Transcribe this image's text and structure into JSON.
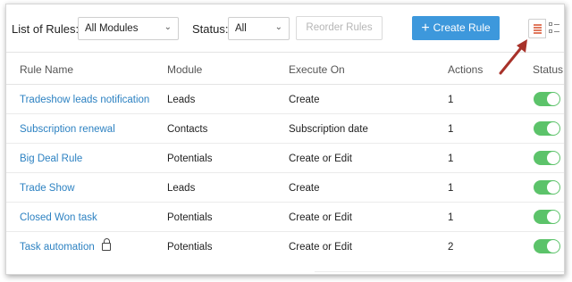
{
  "toolbar": {
    "list_label": "List of Rules:",
    "module_select": "All Modules",
    "status_label": "Status:",
    "status_select": "All",
    "reorder_label": "Reorder Rules",
    "create_plus": "+",
    "create_label": "Create Rule"
  },
  "table": {
    "headers": {
      "name": "Rule Name",
      "module": "Module",
      "execute": "Execute On",
      "actions": "Actions",
      "status": "Status"
    },
    "rows": [
      {
        "name": "Tradeshow leads notification",
        "module": "Leads",
        "execute": "Create",
        "actions": "1",
        "status": "on"
      },
      {
        "name": "Subscription renewal",
        "module": "Contacts",
        "execute": "Subscription date",
        "actions": "1",
        "status": "on"
      },
      {
        "name": "Big Deal Rule",
        "module": "Potentials",
        "execute": "Create or Edit",
        "actions": "1",
        "status": "on"
      },
      {
        "name": "Trade Show",
        "module": "Leads",
        "execute": "Create",
        "actions": "1",
        "status": "on"
      },
      {
        "name": "Closed Won task",
        "module": "Potentials",
        "execute": "Create or Edit",
        "actions": "1",
        "status": "on"
      },
      {
        "name": "Task automation",
        "module": "Potentials",
        "execute": "Create or Edit",
        "actions": "2",
        "status": "on",
        "locked": true
      }
    ]
  },
  "colors": {
    "accent": "#3d98dc",
    "link": "#2d82c2",
    "toggle_on": "#5cc36a",
    "annotation_arrow": "#a8322a"
  },
  "icons": [
    "chevron-down-icon",
    "list-view-icon",
    "grid-view-icon",
    "lock-icon",
    "annotation-arrow"
  ]
}
